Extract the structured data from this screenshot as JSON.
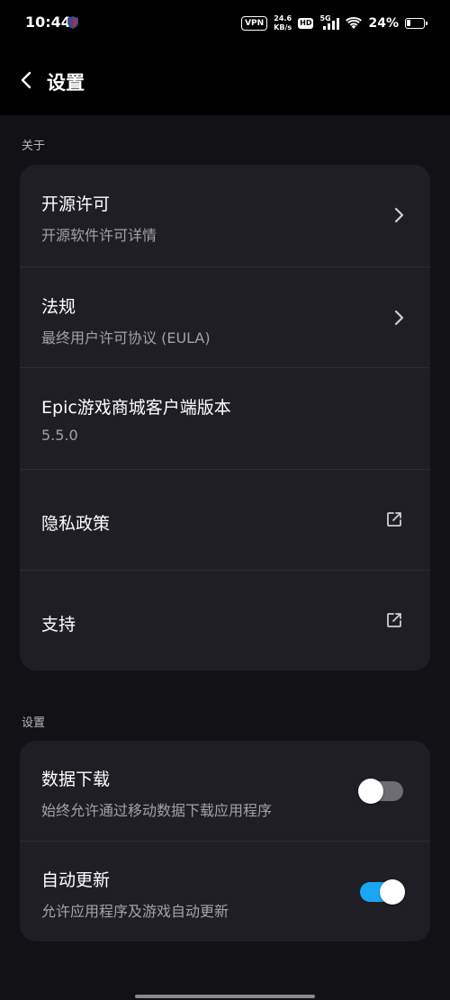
{
  "status_bar": {
    "time": "10:44",
    "vpn": "VPN",
    "speed_value": "24.6",
    "speed_unit": "KB/s",
    "hd": "HD",
    "network": "5G",
    "battery": "24%",
    "battery_level": 0.24
  },
  "header": {
    "title": "设置"
  },
  "about": {
    "label": "关于",
    "items": [
      {
        "title": "开源许可",
        "subtitle": "开源软件许可详情"
      },
      {
        "title": "法规",
        "subtitle": "最终用户许可协议 (EULA)"
      },
      {
        "title": "Epic游戏商城客户端版本",
        "subtitle": "5.5.0"
      },
      {
        "title": "隐私政策"
      },
      {
        "title": "支持"
      }
    ]
  },
  "settings": {
    "label": "设置",
    "items": [
      {
        "title": "数据下载",
        "subtitle": "始终允许通过移动数据下载应用程序",
        "enabled": false
      },
      {
        "title": "自动更新",
        "subtitle": "允许应用程序及游戏自动更新",
        "enabled": true
      }
    ]
  },
  "colors": {
    "background": "#121115",
    "card": "#1f1e24",
    "toggle_on": "#1aa6f2",
    "toggle_off": "#6e6d73"
  }
}
